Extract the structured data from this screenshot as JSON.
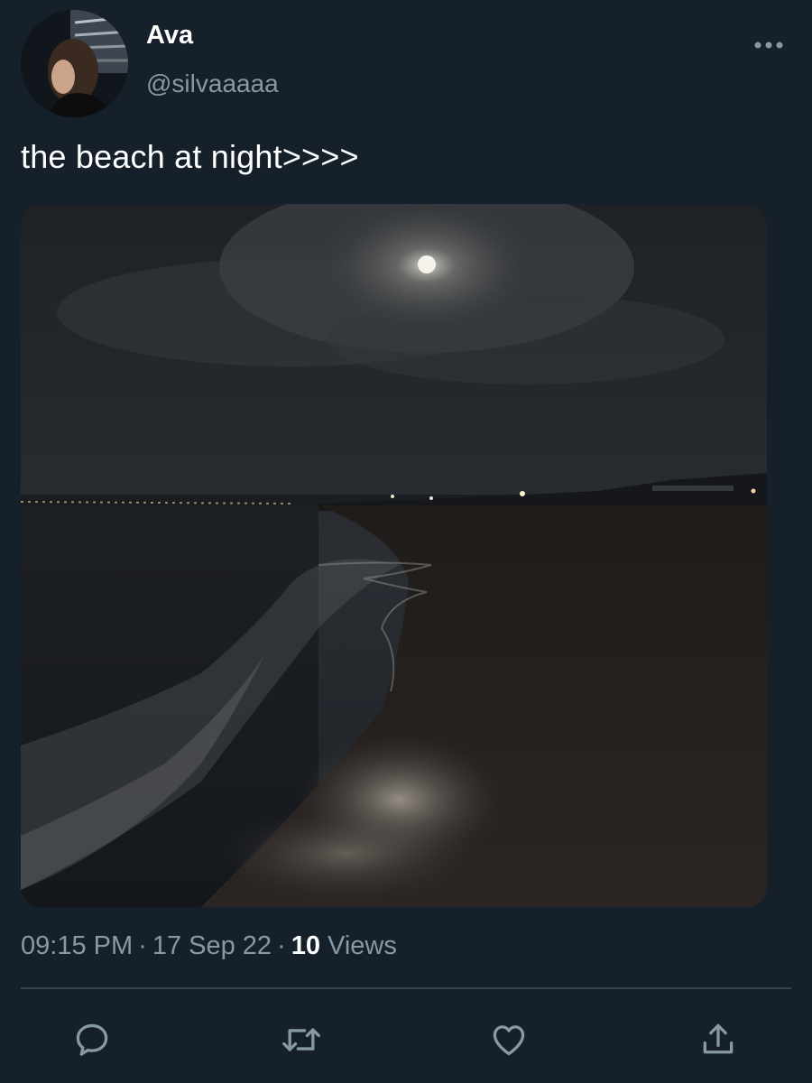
{
  "author": {
    "display_name": "Ava",
    "handle": "@silvaaaaa",
    "avatar": "profile-photo"
  },
  "tweet": {
    "text": "the beach at night>>>>",
    "media": "photo-night-beach-moon"
  },
  "meta": {
    "time": "09:15 PM",
    "separator": "·",
    "date": "17 Sep 22",
    "views_count": "10",
    "views_label": "Views"
  },
  "actions": {
    "reply_icon": "reply-icon",
    "retweet_icon": "retweet-icon",
    "like_icon": "heart-icon",
    "share_icon": "share-icon",
    "more_icon": "more-icon"
  },
  "colors": {
    "background": "#15202b",
    "text_primary": "#ffffff",
    "text_secondary": "#8899a6",
    "divider": "#38444d"
  }
}
